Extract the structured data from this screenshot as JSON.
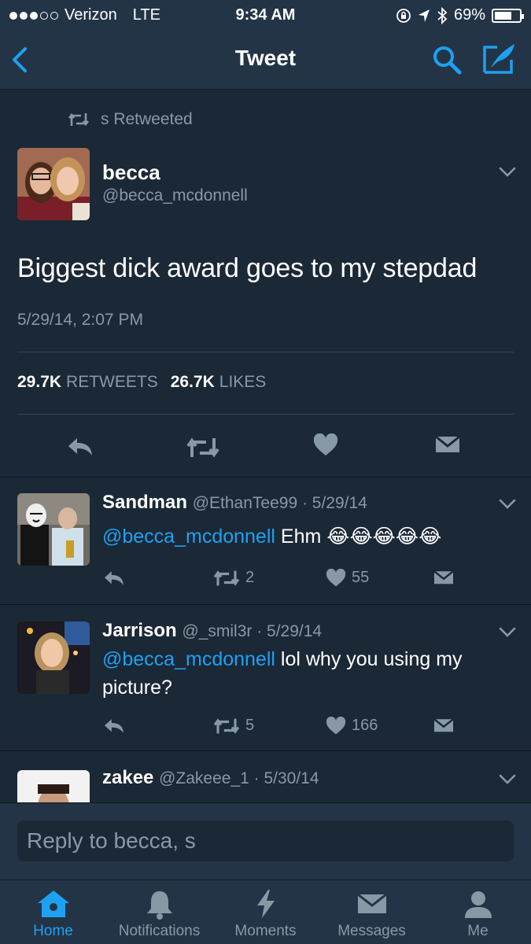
{
  "status_bar": {
    "carrier": "Verizon",
    "network": "LTE",
    "time": "9:34 AM",
    "battery": "69%",
    "battery_level": 0.69
  },
  "nav": {
    "title": "Tweet",
    "accent": "#1da1f2"
  },
  "retweet_context": "s Retweeted",
  "tweet": {
    "name": "becca",
    "handle": "@becca_mcdonnell",
    "text": "Biggest dick award goes to my stepdad",
    "timestamp": "5/29/14, 2:07 PM",
    "retweets_count": "29.7K",
    "retweets_label": "RETWEETS",
    "likes_count": "26.7K",
    "likes_label": "LIKES"
  },
  "replies": [
    {
      "name": "Sandman",
      "meta": "@EthanTee99 · 5/29/14",
      "mention": "@becca_mcdonnell",
      "text": " Ehm 😂😂😂😂😂",
      "retweets": "2",
      "likes": "55"
    },
    {
      "name": "Jarrison",
      "meta": "@_smil3r · 5/29/14",
      "mention": "@becca_mcdonnell",
      "text": " lol why you using my picture?",
      "retweets": "5",
      "likes": "166"
    },
    {
      "name": "zakee",
      "meta": "@Zakeee_1 · 5/30/14"
    }
  ],
  "compose": {
    "placeholder": "Reply to becca, s"
  },
  "tabs": [
    {
      "label": "Home",
      "icon": "home-icon",
      "active": true
    },
    {
      "label": "Notifications",
      "icon": "bell-icon"
    },
    {
      "label": "Moments",
      "icon": "lightning-icon"
    },
    {
      "label": "Messages",
      "icon": "envelope-icon"
    },
    {
      "label": "Me",
      "icon": "person-icon"
    }
  ]
}
